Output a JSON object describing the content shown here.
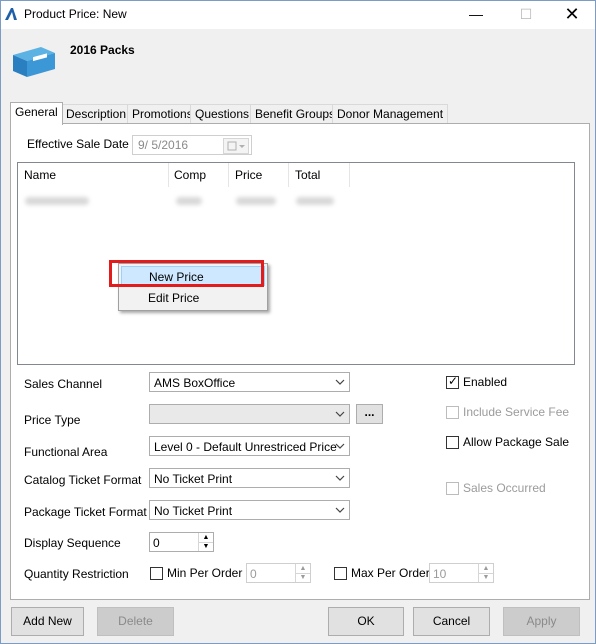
{
  "window": {
    "title": "Product Price: New"
  },
  "header": {
    "product_name": "2016 Packs"
  },
  "tabs": [
    "General",
    "Description",
    "Promotions",
    "Questions",
    "Benefit Groups",
    "Donor Management"
  ],
  "general": {
    "effective_sale_date_label": "Effective Sale Date",
    "effective_sale_date_value": "9/  5/2016",
    "list": {
      "columns": [
        "Name",
        "Comp",
        "Price",
        "Total"
      ]
    },
    "context_menu": {
      "items": [
        "New Price",
        "Edit Price"
      ]
    },
    "sales_channel_label": "Sales Channel",
    "sales_channel_value": "AMS BoxOffice",
    "price_type_label": "Price Type",
    "price_type_value": "",
    "price_type_button": "...",
    "functional_area_label": "Functional Area",
    "functional_area_value": "Level 0 - Default Unrestriced Price",
    "catalog_ticket_format_label": "Catalog Ticket Format",
    "catalog_ticket_format_value": "No Ticket Print",
    "package_ticket_format_label": "Package Ticket Format",
    "package_ticket_format_value": "No Ticket Print",
    "display_sequence_label": "Display Sequence",
    "display_sequence_value": "0",
    "quantity_restriction_label": "Quantity Restriction",
    "min_per_order_label": "Min Per Order",
    "min_per_order_value": "0",
    "max_per_order_label": "Max Per Order",
    "max_per_order_value": "10",
    "enabled_label": "Enabled",
    "include_service_fee_label": "Include Service Fee",
    "allow_package_sale_label": "Allow Package Sale",
    "sales_occurred_label": "Sales Occurred"
  },
  "footer": {
    "add_new": "Add New",
    "delete": "Delete",
    "ok": "OK",
    "cancel": "Cancel",
    "apply": "Apply"
  },
  "colors": {
    "highlight_border": "#e21c1c",
    "menu_highlight": "#cde8ff",
    "title_icon": "#1f5fa8"
  }
}
